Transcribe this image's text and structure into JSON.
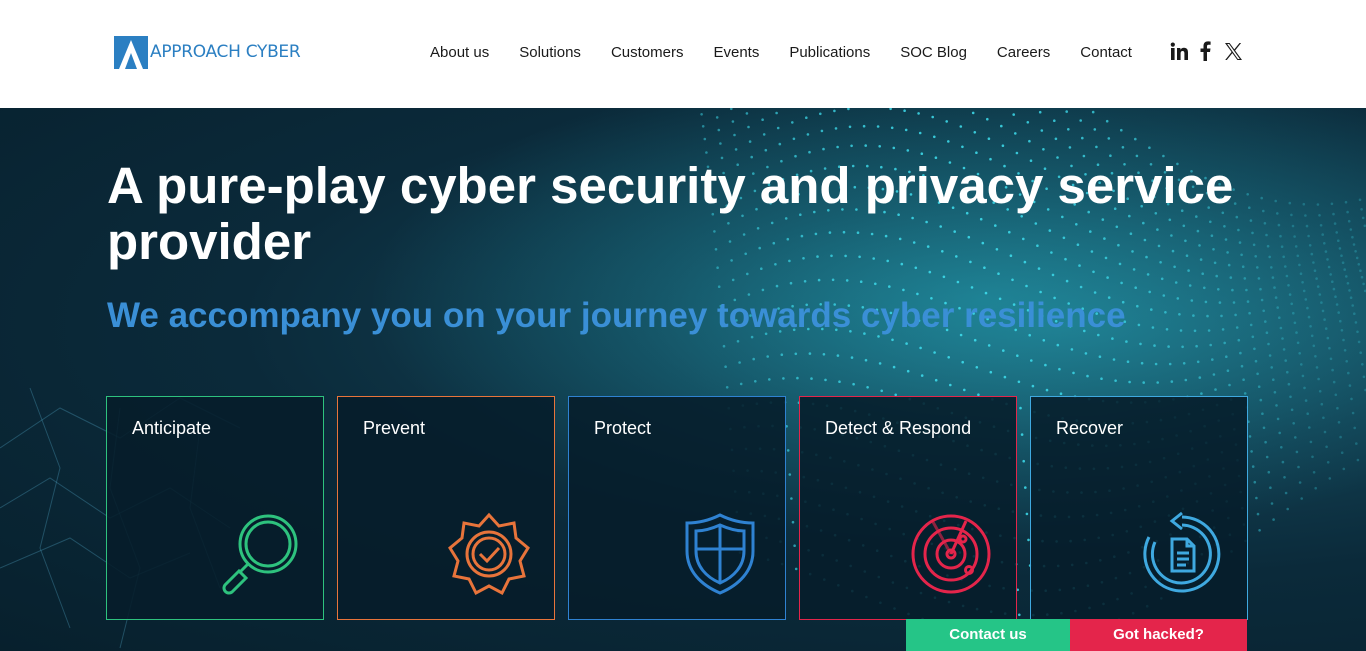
{
  "header": {
    "logo_text": "APPROACH CYBER",
    "nav": [
      {
        "label": "About us"
      },
      {
        "label": "Solutions"
      },
      {
        "label": "Customers"
      },
      {
        "label": "Events"
      },
      {
        "label": "Publications"
      },
      {
        "label": "SOC Blog"
      },
      {
        "label": "Careers"
      },
      {
        "label": "Contact"
      }
    ],
    "social": [
      "linkedin-icon",
      "facebook-icon",
      "x-icon"
    ]
  },
  "hero": {
    "title": "A pure-play cyber security and privacy service provider",
    "subtitle": "We accompany you on your journey towards cyber resilience",
    "cards": [
      {
        "label": "Anticipate",
        "icon": "magnifier-icon",
        "color": "#2ec27e"
      },
      {
        "label": "Prevent",
        "icon": "badge-check-icon",
        "color": "#e8743b"
      },
      {
        "label": "Protect",
        "icon": "shield-icon",
        "color": "#2f82d2"
      },
      {
        "label": "Detect & Respond",
        "icon": "radar-icon",
        "color": "#e4254b"
      },
      {
        "label": "Recover",
        "icon": "recover-document-icon",
        "color": "#3fa9e0"
      }
    ]
  },
  "cta": {
    "contact_label": "Contact us",
    "hacked_label": "Got hacked?"
  },
  "colors": {
    "brand_blue": "#2b7fc2",
    "subtitle_blue": "#3a8fd6",
    "contact_green": "#25c587",
    "hacked_red": "#e4254b"
  }
}
